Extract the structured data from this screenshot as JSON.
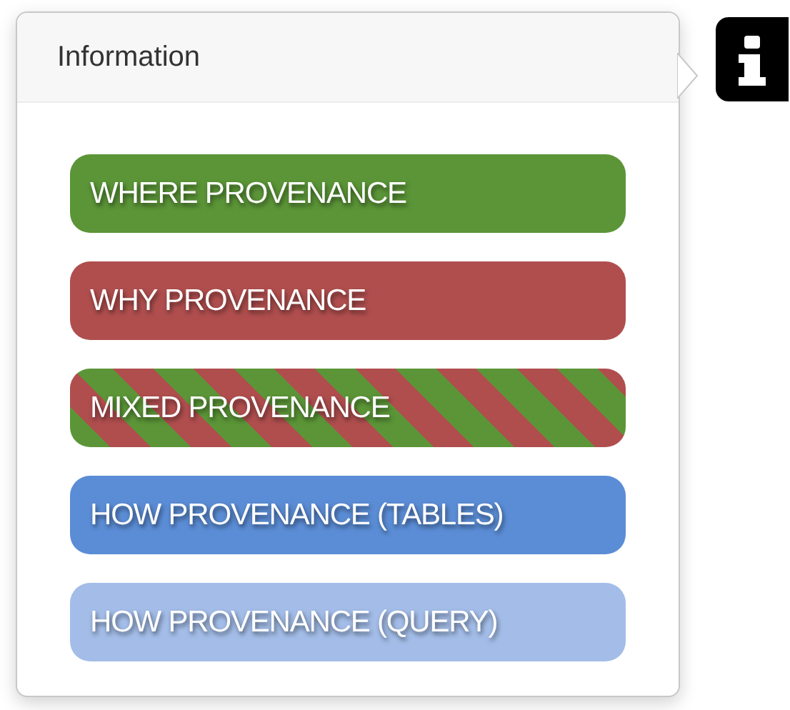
{
  "popover": {
    "title": "Information"
  },
  "legend": [
    {
      "label": "WHERE PROVENANCE",
      "kind": "solid",
      "color": "#5b9537"
    },
    {
      "label": "WHY PROVENANCE",
      "kind": "solid",
      "color": "#b04e4e"
    },
    {
      "label": "MIXED PROVENANCE",
      "kind": "striped",
      "stripes": [
        {
          "color": "#5b9537"
        },
        {
          "color": "#b04e4e"
        }
      ]
    },
    {
      "label": "HOW PROVENANCE (TABLES)",
      "kind": "solid",
      "color": "#5b8dd6"
    },
    {
      "label": "HOW PROVENANCE (QUERY)",
      "kind": "solid",
      "color": "#a3bde8"
    }
  ]
}
